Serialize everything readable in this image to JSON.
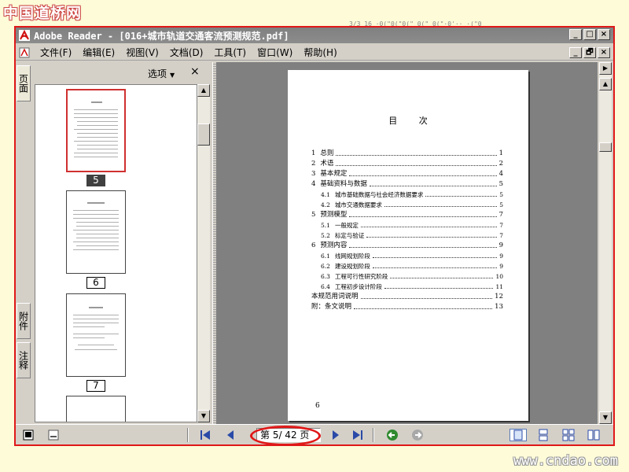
{
  "watermark": {
    "site_logo": "中国道桥网",
    "site_url": "www.cndao.com",
    "top_text": "3/3 16 ·0(\"0(\"0(\" 0(\"  0(\"·0'··  ·(\"0"
  },
  "window": {
    "title": "Adobe Reader - [016+城市轨道交通客流预测规范.pdf]",
    "controls": [
      "_",
      "□",
      "×"
    ],
    "doc_controls": [
      "_",
      "🗗",
      "×"
    ]
  },
  "menu": [
    "文件(F)",
    "编辑(E)",
    "视图(V)",
    "文档(D)",
    "工具(T)",
    "窗口(W)",
    "帮助(H)"
  ],
  "sidebar_tabs": {
    "pages": "页面",
    "attachments": "附件",
    "comments": "注释"
  },
  "thumbnails": {
    "options_label": "选项",
    "close_label": "×",
    "pages": [
      "5",
      "6",
      "7"
    ],
    "selected": "5"
  },
  "document": {
    "heading": "目  次",
    "footer_page_number": "6",
    "toc": [
      {
        "num": "1",
        "title": "总则",
        "page": "1",
        "level": 1
      },
      {
        "num": "2",
        "title": "术语",
        "page": "2",
        "level": 1
      },
      {
        "num": "3",
        "title": "基本规定",
        "page": "4",
        "level": 1
      },
      {
        "num": "4",
        "title": "基础资料与数据",
        "page": "5",
        "level": 1
      },
      {
        "num": "4.1",
        "title": "城市基础数据与社会经济数据要求",
        "page": "5",
        "level": 2
      },
      {
        "num": "4.2",
        "title": "城市交通数据要求",
        "page": "5",
        "level": 2
      },
      {
        "num": "5",
        "title": "预测模型",
        "page": "7",
        "level": 1
      },
      {
        "num": "5.1",
        "title": "一般规定",
        "page": "7",
        "level": 2
      },
      {
        "num": "5.2",
        "title": "标定与验证",
        "page": "7",
        "level": 2
      },
      {
        "num": "6",
        "title": "预测内容",
        "page": "9",
        "level": 1
      },
      {
        "num": "6.1",
        "title": "线网规划阶段",
        "page": "9",
        "level": 2
      },
      {
        "num": "6.2",
        "title": "建设规划阶段",
        "page": "9",
        "level": 2
      },
      {
        "num": "6.3",
        "title": "工程可行性研究阶段",
        "page": "10",
        "level": 2
      },
      {
        "num": "6.4",
        "title": "工程初步设计阶段",
        "page": "11",
        "level": 2
      },
      {
        "num": "",
        "title": "本规范用词说明",
        "page": "12",
        "level": 1
      },
      {
        "num": "",
        "title": "附：条文说明",
        "page": "13",
        "level": 1
      }
    ]
  },
  "statusbar": {
    "page_indicator": "第 5/ 42 页",
    "current_page": 5,
    "total_pages": 42
  }
}
